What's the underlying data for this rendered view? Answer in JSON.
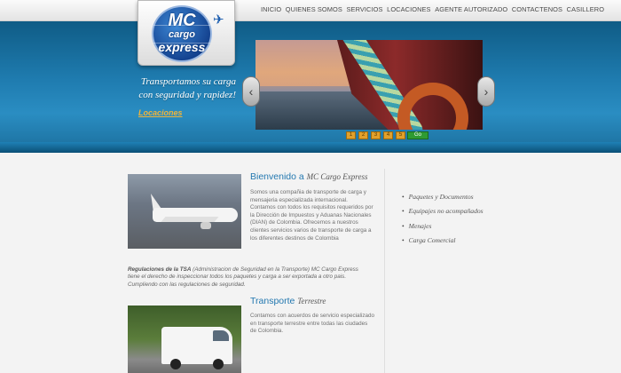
{
  "nav": [
    "INICIO",
    "QUIENES SOMOS",
    "SERVICIOS",
    "LOCACIONES",
    "AGENTE AUTORIZADO",
    "CONTACTENOS",
    "CASILLERO"
  ],
  "logo": {
    "line1": "MC",
    "line2": "cargo",
    "line3": "express"
  },
  "hero": {
    "tagline": "Transportamos su carga con seguridad y rapidez!",
    "locations_link": "Locaciones",
    "slider_pages": [
      "1",
      "2",
      "3",
      "4",
      "5"
    ],
    "go_label": "Go"
  },
  "welcome": {
    "title": "Bienvenido a",
    "title_em": "MC Cargo Express",
    "body": "Somos una compañia de transporte de carga y mensajeria especializada internacional. Contamos con todos los requisitos requeridos por la Dirección de Impuestos y Aduanas Nacionales (DIAN) de Colombia. Ofrecemos a nuestros clientes servicios varios de transporte de carga a los diferentes destinos de Colombia"
  },
  "notice": {
    "bold": "Regulaciones de la TSA",
    "text": " (Administracion de Seguridad en la Transporte) MC Cargo Express tiene el derecho de inspeccionar todos los paquetes y carga a ser exportada a otro pais. Cumpliendo con las regulaciones de seguridad."
  },
  "transport": {
    "title": "Transporte",
    "title_em": "Terrestre",
    "body": "Contamos con acuerdos de servicio especializado en transporte terrestre entre todas las ciudades de Colombia."
  },
  "services": [
    "Paquetes y Documentos",
    "Equipajes no acompañados",
    "Menajes",
    "Carga Comercial"
  ],
  "colors": {
    "hero_blue": "#1f7cb0",
    "link_orange": "#f0b43a",
    "heading_blue": "#2378b0",
    "go_green": "#2f9b32"
  }
}
